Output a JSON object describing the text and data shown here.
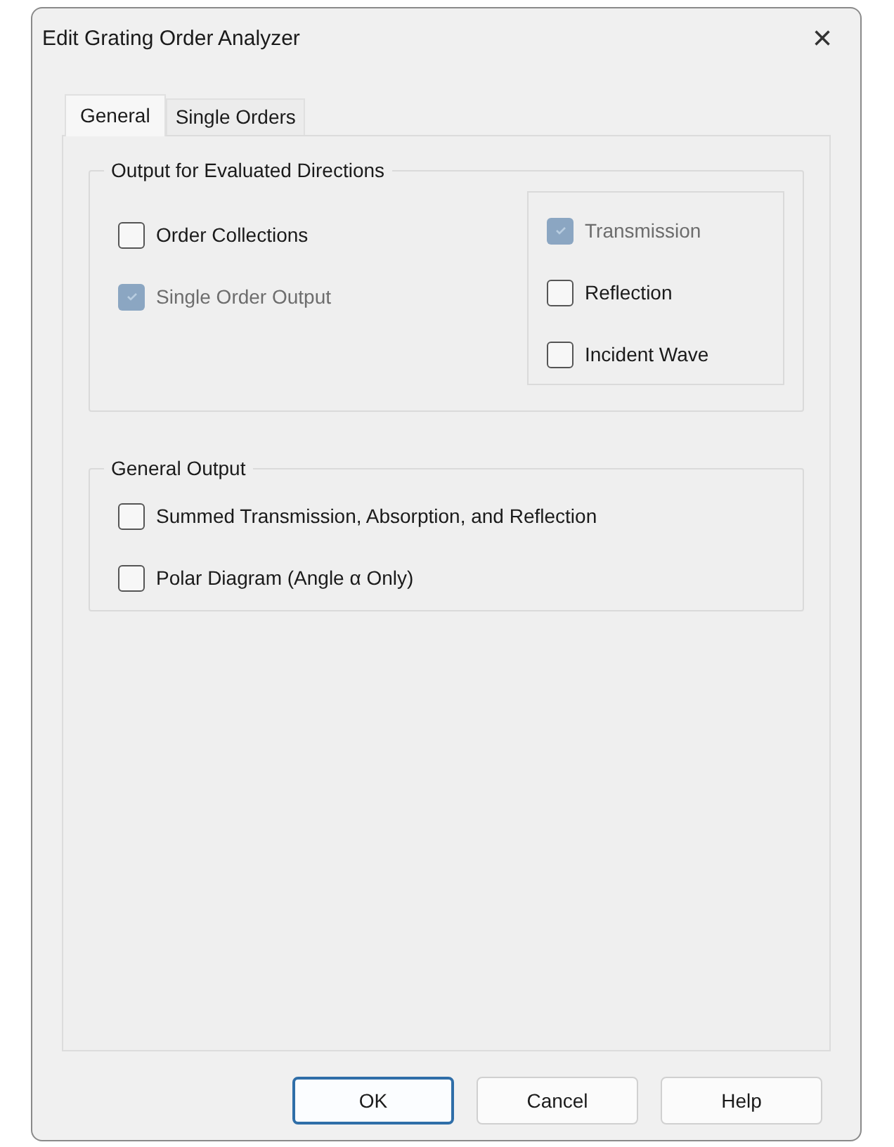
{
  "window": {
    "title": "Edit Grating Order Analyzer",
    "close": "×"
  },
  "tabs": [
    {
      "label": "General",
      "selected": true
    },
    {
      "label": "Single Orders",
      "selected": false
    }
  ],
  "groups": [
    {
      "title": "Output for Evaluated Directions",
      "left": [
        {
          "label": "Order Collections",
          "checked": false,
          "disabled": false
        },
        {
          "label": "Single Order Output",
          "checked": true,
          "disabled": true
        }
      ],
      "right": [
        {
          "label": "Transmission",
          "checked": true,
          "disabled": true
        },
        {
          "label": "Reflection",
          "checked": false,
          "disabled": false
        },
        {
          "label": "Incident Wave",
          "checked": false,
          "disabled": false
        }
      ]
    },
    {
      "title": "General Output",
      "left": [
        {
          "label": "Summed Transmission, Absorption, and Reflection",
          "checked": false,
          "disabled": false
        },
        {
          "label": "Polar Diagram (Angle α Only)",
          "checked": false,
          "disabled": false
        }
      ]
    }
  ],
  "buttons": [
    {
      "label": "OK",
      "default": true
    },
    {
      "label": "Cancel",
      "default": false
    },
    {
      "label": "Help",
      "default": false
    }
  ]
}
